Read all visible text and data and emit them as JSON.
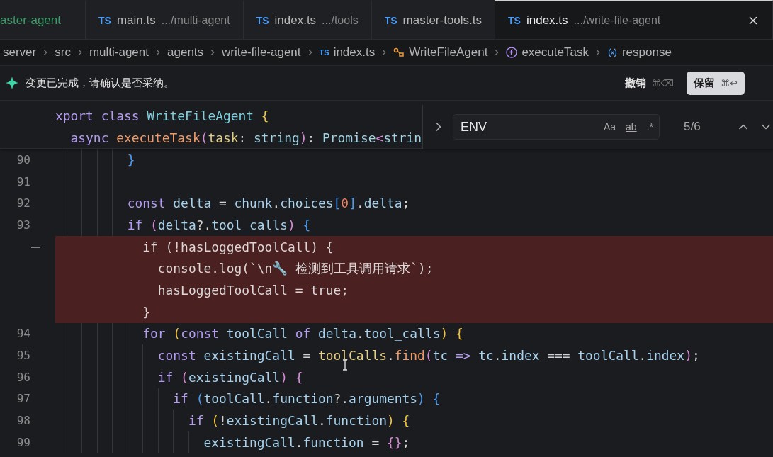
{
  "tabs": [
    {
      "label": "aster-agent",
      "color": "#3f9a6a",
      "selected": false
    },
    {
      "badge": "TS",
      "label": "main.ts",
      "path": ".../multi-agent",
      "selected": false
    },
    {
      "badge": "TS",
      "label": "index.ts",
      "path": ".../tools",
      "selected": false
    },
    {
      "badge": "TS",
      "label": "master-tools.ts",
      "selected": false
    },
    {
      "badge": "TS",
      "label": "index.ts",
      "path": ".../write-file-agent",
      "selected": true
    }
  ],
  "breadcrumbs": [
    {
      "kind": "folder",
      "label": "server"
    },
    {
      "kind": "folder",
      "label": "src"
    },
    {
      "kind": "folder",
      "label": "multi-agent"
    },
    {
      "kind": "folder",
      "label": "agents"
    },
    {
      "kind": "folder",
      "label": "write-file-agent"
    },
    {
      "kind": "file",
      "badge": "TS",
      "label": "index.ts"
    },
    {
      "kind": "class",
      "label": "WriteFileAgent"
    },
    {
      "kind": "function",
      "label": "executeTask"
    },
    {
      "kind": "variable",
      "label": "response"
    }
  ],
  "notice": {
    "message": "变更已完成，请确认是否采纳。",
    "undo": {
      "label": "撤销",
      "shortcut": "⌘⌫"
    },
    "keep": {
      "label": "保留",
      "shortcut": "⌘↩"
    }
  },
  "sticky_lines": [
    [
      {
        "text": "xport class ",
        "kind": "kw"
      },
      {
        "text": "WriteFileAgent ",
        "kind": "cls"
      },
      {
        "text": "{",
        "kind": "b1"
      }
    ],
    [
      {
        "text": "  async ",
        "kind": "kw"
      },
      {
        "text": "executeTask",
        "kind": "fn"
      },
      {
        "text": "(",
        "kind": "b2"
      },
      {
        "text": "task",
        "kind": "param"
      },
      {
        "text": ": ",
        "kind": "op"
      },
      {
        "text": "string",
        "kind": "type"
      },
      {
        "text": ")",
        "kind": "b2"
      },
      {
        "text": ": ",
        "kind": "op"
      },
      {
        "text": "Promise",
        "kind": "type"
      },
      {
        "text": "<",
        "kind": "b2"
      },
      {
        "text": "strin",
        "kind": "type"
      }
    ]
  ],
  "find": {
    "value": "ENV",
    "options": [
      "Aa",
      "ab",
      ".*"
    ],
    "count": "5/6"
  },
  "lines": [
    {
      "kind": "normal",
      "number": "90",
      "tokens": [
        {
          "text": "          }",
          "kind": "b3"
        }
      ]
    },
    {
      "kind": "normal",
      "number": "91"
    },
    {
      "kind": "normal",
      "number": "92",
      "tokens": [
        {
          "text": "          const ",
          "kind": "kw"
        },
        {
          "text": "delta",
          "kind": "var"
        },
        {
          "text": " = ",
          "kind": "op"
        },
        {
          "text": "chunk",
          "kind": "var"
        },
        {
          "text": ".",
          "kind": "op"
        },
        {
          "text": "choices",
          "kind": "var"
        },
        {
          "text": "[",
          "kind": "b3"
        },
        {
          "text": "0",
          "kind": "num"
        },
        {
          "text": "]",
          "kind": "b3"
        },
        {
          "text": ".",
          "kind": "op"
        },
        {
          "text": "delta",
          "kind": "var"
        },
        {
          "text": ";",
          "kind": "op"
        }
      ]
    },
    {
      "kind": "normal",
      "number": "93",
      "tokens": [
        {
          "text": "          if ",
          "kind": "kw"
        },
        {
          "text": "(",
          "kind": "b2"
        },
        {
          "text": "delta",
          "kind": "var"
        },
        {
          "text": "?.",
          "kind": "op"
        },
        {
          "text": "tool_calls",
          "kind": "var"
        },
        {
          "text": ") ",
          "kind": "b2"
        },
        {
          "text": "{",
          "kind": "b3"
        }
      ]
    },
    {
      "kind": "deleted",
      "marker": "—",
      "tokens": [
        {
          "text": "            if (!hasLoggedToolCall) {",
          "kind": "del"
        }
      ]
    },
    {
      "kind": "deleted",
      "tokens": [
        {
          "text": "              console.log(`\\n🔧 检测到工具调用请求`);",
          "kind": "del"
        }
      ]
    },
    {
      "kind": "deleted",
      "tokens": [
        {
          "text": "              hasLoggedToolCall = true;",
          "kind": "del"
        }
      ]
    },
    {
      "kind": "deleted",
      "tokens": [
        {
          "text": "            }",
          "kind": "del"
        }
      ]
    },
    {
      "kind": "normal",
      "number": "94",
      "tokens": [
        {
          "text": "            for ",
          "kind": "kw"
        },
        {
          "text": "(",
          "kind": "b1"
        },
        {
          "text": "const ",
          "kind": "kw"
        },
        {
          "text": "toolCall ",
          "kind": "var"
        },
        {
          "text": "of ",
          "kind": "kw"
        },
        {
          "text": "delta",
          "kind": "var"
        },
        {
          "text": ".",
          "kind": "op"
        },
        {
          "text": "tool_calls",
          "kind": "var"
        },
        {
          "text": ") ",
          "kind": "b1"
        },
        {
          "text": "{",
          "kind": "b1"
        }
      ]
    },
    {
      "kind": "normal",
      "number": "95",
      "tokens": [
        {
          "text": "              const ",
          "kind": "kw"
        },
        {
          "text": "existingCall",
          "kind": "var"
        },
        {
          "text": " = ",
          "kind": "op"
        },
        {
          "text": "toolCalls",
          "kind": "fnv"
        },
        {
          "text": ".",
          "kind": "op"
        },
        {
          "text": "find",
          "kind": "fn"
        },
        {
          "text": "(",
          "kind": "b2"
        },
        {
          "text": "tc",
          "kind": "var"
        },
        {
          "text": " => ",
          "kind": "kw"
        },
        {
          "text": "tc",
          "kind": "var"
        },
        {
          "text": ".",
          "kind": "op"
        },
        {
          "text": "index",
          "kind": "var"
        },
        {
          "text": " === ",
          "kind": "op"
        },
        {
          "text": "toolCall",
          "kind": "var"
        },
        {
          "text": ".",
          "kind": "op"
        },
        {
          "text": "index",
          "kind": "var"
        },
        {
          "text": ")",
          "kind": "b2"
        },
        {
          "text": ";",
          "kind": "op"
        }
      ]
    },
    {
      "kind": "normal",
      "number": "96",
      "tokens": [
        {
          "text": "              if ",
          "kind": "kw"
        },
        {
          "text": "(",
          "kind": "b2"
        },
        {
          "text": "existingCall",
          "kind": "var"
        },
        {
          "text": ") {",
          "kind": "b2"
        }
      ]
    },
    {
      "kind": "normal",
      "number": "97",
      "tokens": [
        {
          "text": "                if ",
          "kind": "kw"
        },
        {
          "text": "(",
          "kind": "b3"
        },
        {
          "text": "toolCall",
          "kind": "var"
        },
        {
          "text": ".",
          "kind": "op"
        },
        {
          "text": "function",
          "kind": "var"
        },
        {
          "text": "?.",
          "kind": "op"
        },
        {
          "text": "arguments",
          "kind": "var"
        },
        {
          "text": ") {",
          "kind": "b3"
        }
      ]
    },
    {
      "kind": "normal",
      "number": "98",
      "tokens": [
        {
          "text": "                  if ",
          "kind": "kw"
        },
        {
          "text": "(",
          "kind": "b1"
        },
        {
          "text": "!",
          "kind": "op"
        },
        {
          "text": "existingCall",
          "kind": "var"
        },
        {
          "text": ".",
          "kind": "op"
        },
        {
          "text": "function",
          "kind": "var"
        },
        {
          "text": ") {",
          "kind": "b1"
        }
      ]
    },
    {
      "kind": "normal",
      "number": "99",
      "tokens": [
        {
          "text": "                    existingCall",
          "kind": "var"
        },
        {
          "text": ".",
          "kind": "op"
        },
        {
          "text": "function",
          "kind": "var"
        },
        {
          "text": " = ",
          "kind": "op"
        },
        {
          "text": "{}",
          "kind": "b2"
        },
        {
          "text": ";",
          "kind": "op"
        }
      ]
    }
  ]
}
